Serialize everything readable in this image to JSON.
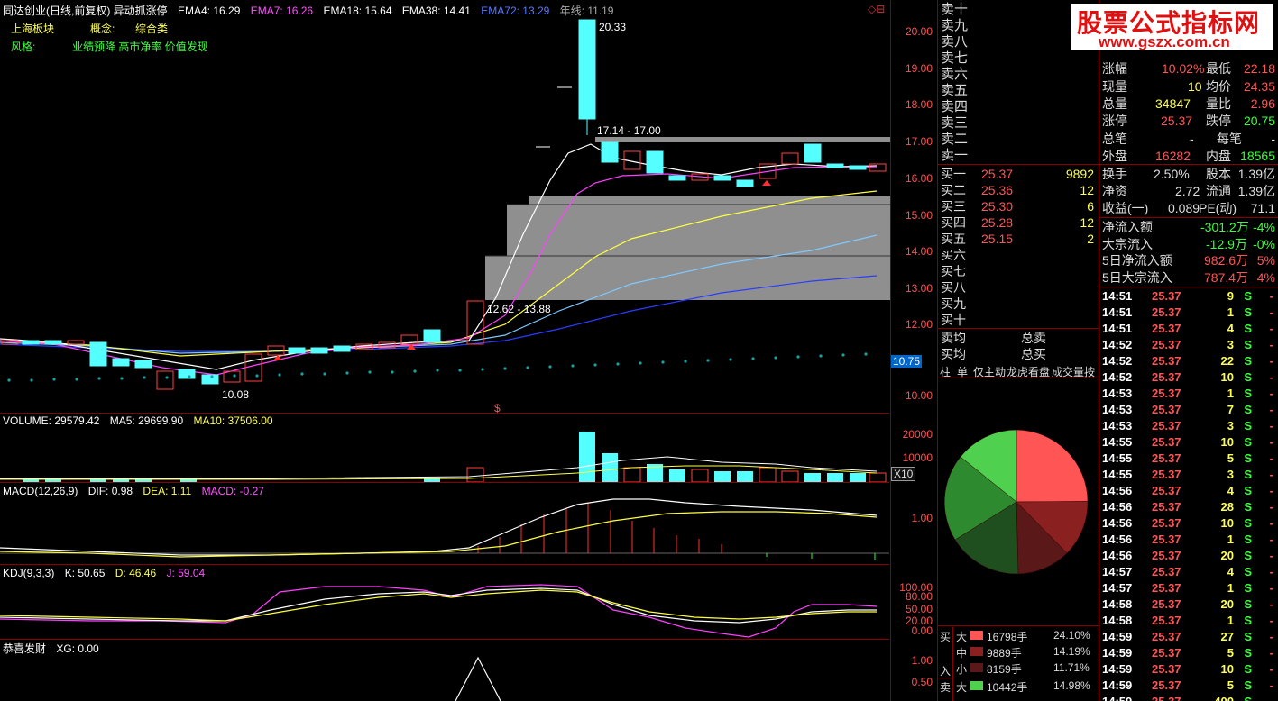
{
  "header": {
    "title": "同达创业(日线,前复权) 异动抓涨停",
    "ema4": "EMA4: 16.29",
    "ema7": "EMA7: 16.26",
    "ema18": "EMA18: 15.64",
    "ema38": "EMA38: 14.41",
    "ema72": "EMA72: 13.29",
    "yearline": "年线: 11.19",
    "sector_label": "上海板块",
    "concept_label": "概念:",
    "concept_value": "综合类",
    "style_label": "风格:",
    "style_value": "业绩预降 高市净率 价值发现"
  },
  "price_axis": [
    "20.00",
    "19.00",
    "18.00",
    "17.00",
    "16.00",
    "15.00",
    "14.00",
    "13.00",
    "12.00",
    "11.00",
    "10.00"
  ],
  "price_annotations": {
    "high": "20.33",
    "low": "10.08",
    "gap1": "17.14 - 17.00",
    "gap2": "12.62 - 13.88",
    "marker": "10.75",
    "s_mark": "$"
  },
  "volume": {
    "label": "VOLUME: 29579.42",
    "ma5": "MA5: 29699.90",
    "ma10": "MA10: 37506.00",
    "axis": [
      "20000",
      "10000"
    ],
    "unit": "X10"
  },
  "macd": {
    "label": "MACD(12,26,9)",
    "dif": "DIF: 0.98",
    "dea": "DEA: 1.11",
    "macd": "MACD: -0.27",
    "axis": [
      "1.00"
    ]
  },
  "kdj": {
    "label": "KDJ(9,3,3)",
    "k": "K: 50.65",
    "d": "D: 46.46",
    "j": "J: 59.04",
    "axis": [
      "100.00",
      "80.00",
      "50.00",
      "20.00",
      "0.00"
    ]
  },
  "xg": {
    "label": "恭喜发财",
    "xg": "XG: 0.00",
    "axis": [
      "1.00",
      "0.50"
    ]
  },
  "sell_levels": [
    "卖十",
    "卖九",
    "卖八",
    "卖七",
    "卖六",
    "卖五",
    "卖四",
    "卖三",
    "卖二",
    "卖一"
  ],
  "buy_levels": [
    {
      "label": "买一",
      "price": "25.37",
      "vol": "9892"
    },
    {
      "label": "买二",
      "price": "25.36",
      "vol": "12"
    },
    {
      "label": "买三",
      "price": "25.30",
      "vol": "6"
    },
    {
      "label": "买四",
      "price": "25.28",
      "vol": "12"
    },
    {
      "label": "买五",
      "price": "25.15",
      "vol": "2"
    },
    {
      "label": "买六",
      "price": "",
      "vol": ""
    },
    {
      "label": "买七",
      "price": "",
      "vol": ""
    },
    {
      "label": "买八",
      "price": "",
      "vol": ""
    },
    {
      "label": "买九",
      "price": "",
      "vol": ""
    },
    {
      "label": "买十",
      "price": "",
      "vol": ""
    }
  ],
  "avg": {
    "sell_avg": "卖均",
    "buy_avg": "买均",
    "total_sell": "总卖",
    "total_buy": "总买"
  },
  "tabs": [
    "柱",
    "单",
    "仅主动",
    "龙虎看盘",
    "成交量按"
  ],
  "logo": {
    "line1": "股票公式指标网",
    "line2": "www.gszx.com.cn"
  },
  "quote": [
    {
      "l1": "涨幅",
      "v1": "10.02%",
      "l2": "最低",
      "v2": "22.18"
    },
    {
      "l1": "现量",
      "v1": "10",
      "l2": "均价",
      "v2": "24.35"
    },
    {
      "l1": "总量",
      "v1": "34847",
      "l2": "量比",
      "v2": "2.96"
    },
    {
      "l1": "涨停",
      "v1": "25.37",
      "l2": "跌停",
      "v2": "20.75"
    },
    {
      "l1": "总笔",
      "v1": "-",
      "l2": "每笔",
      "v2": "-"
    },
    {
      "l1": "外盘",
      "v1": "16282",
      "l2": "内盘",
      "v2": "18565"
    },
    {
      "l1": "换手",
      "v1": "2.50%",
      "l2": "股本",
      "v2": "1.39亿"
    },
    {
      "l1": "净资",
      "v1": "2.72",
      "l2": "流通",
      "v2": "1.39亿"
    },
    {
      "l1": "收益(一)",
      "v1": "0.089",
      "l2": "PE(动)",
      "v2": "71.1"
    }
  ],
  "flows": [
    {
      "label": "净流入额",
      "value": "-301.2万",
      "pct": "-4%"
    },
    {
      "label": "大宗流入",
      "value": "-12.9万",
      "pct": "-0%"
    },
    {
      "label": "5日净流入额",
      "value": "982.6万",
      "pct": "5%"
    },
    {
      "label": "5日大宗流入",
      "value": "787.4万",
      "pct": "4%"
    }
  ],
  "ticks": [
    {
      "t": "14:51",
      "p": "25.37",
      "v": "9",
      "s": "S"
    },
    {
      "t": "14:51",
      "p": "25.37",
      "v": "1",
      "s": "S"
    },
    {
      "t": "14:51",
      "p": "25.37",
      "v": "4",
      "s": "S"
    },
    {
      "t": "14:52",
      "p": "25.37",
      "v": "3",
      "s": "S"
    },
    {
      "t": "14:52",
      "p": "25.37",
      "v": "22",
      "s": "S"
    },
    {
      "t": "14:52",
      "p": "25.37",
      "v": "10",
      "s": "S"
    },
    {
      "t": "14:53",
      "p": "25.37",
      "v": "1",
      "s": "S"
    },
    {
      "t": "14:53",
      "p": "25.37",
      "v": "7",
      "s": "S"
    },
    {
      "t": "14:53",
      "p": "25.37",
      "v": "3",
      "s": "S"
    },
    {
      "t": "14:55",
      "p": "25.37",
      "v": "10",
      "s": "S"
    },
    {
      "t": "14:55",
      "p": "25.37",
      "v": "5",
      "s": "S"
    },
    {
      "t": "14:55",
      "p": "25.37",
      "v": "3",
      "s": "S"
    },
    {
      "t": "14:56",
      "p": "25.37",
      "v": "4",
      "s": "S"
    },
    {
      "t": "14:56",
      "p": "25.37",
      "v": "28",
      "s": "S"
    },
    {
      "t": "14:56",
      "p": "25.37",
      "v": "10",
      "s": "S"
    },
    {
      "t": "14:56",
      "p": "25.37",
      "v": "1",
      "s": "S"
    },
    {
      "t": "14:56",
      "p": "25.37",
      "v": "20",
      "s": "S"
    },
    {
      "t": "14:57",
      "p": "25.37",
      "v": "4",
      "s": "S"
    },
    {
      "t": "14:57",
      "p": "25.37",
      "v": "1",
      "s": "S"
    },
    {
      "t": "14:58",
      "p": "25.37",
      "v": "20",
      "s": "S"
    },
    {
      "t": "14:58",
      "p": "25.37",
      "v": "1",
      "s": "S"
    },
    {
      "t": "14:59",
      "p": "25.37",
      "v": "27",
      "s": "S"
    },
    {
      "t": "14:59",
      "p": "25.37",
      "v": "5",
      "s": "S"
    },
    {
      "t": "14:59",
      "p": "25.37",
      "v": "10",
      "s": "S"
    },
    {
      "t": "14:59",
      "p": "25.37",
      "v": "5",
      "s": "S"
    },
    {
      "t": "14:59",
      "p": "25.37",
      "v": "400",
      "s": "S"
    }
  ],
  "capital_flow": {
    "buy_side": "买",
    "in_label": "入",
    "sell_side": "卖",
    "rows": [
      {
        "size": "大",
        "color": "#ff5555",
        "amount": "16798手",
        "pct": "24.10%"
      },
      {
        "size": "中",
        "color": "#8a2020",
        "amount": "9889手",
        "pct": "14.19%"
      },
      {
        "size": "小",
        "color": "#5a1818",
        "amount": "8159手",
        "pct": "11.71%"
      },
      {
        "size": "大",
        "color": "#4fd04f",
        "amount": "10442手",
        "pct": "14.98%"
      }
    ]
  }
}
